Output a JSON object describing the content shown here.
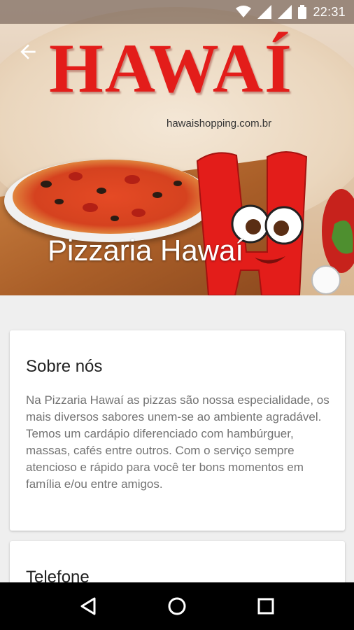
{
  "status_bar": {
    "time": "22:31",
    "icons": [
      "wifi-icon",
      "signal-icon",
      "signal-icon",
      "battery-icon"
    ]
  },
  "hero": {
    "logo_text": "HAWAÍ",
    "logo_subtitle": "hawaishopping.com.br",
    "title": "Pizzaria Hawaí",
    "back_icon": "arrow-back-icon"
  },
  "about": {
    "title": "Sobre nós",
    "body": "Na Pizzaria Hawaí as pizzas são nossa especialidade, os mais diversos sabores unem-se ao ambiente agradável. Temos um cardápio diferenciado com hambúrguer, massas, cafés entre outros. Com o serviço sempre atencioso e rápido para você ter bons momentos em família e/ou entre amigos."
  },
  "phone": {
    "title": "Telefone"
  },
  "nav": {
    "back_icon": "nav-back-icon",
    "home_icon": "nav-home-icon",
    "recents_icon": "nav-recents-icon"
  },
  "colors": {
    "brand_red": "#e31d1a",
    "text_primary": "#212121",
    "text_secondary": "#737373"
  }
}
